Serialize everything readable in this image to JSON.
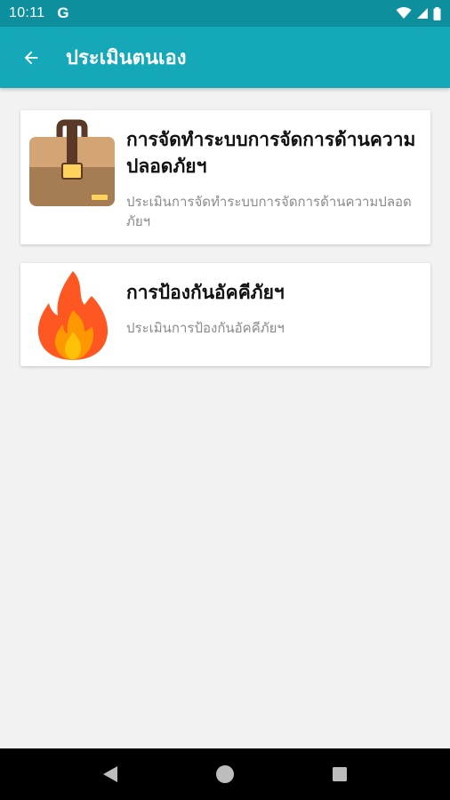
{
  "status_bar": {
    "time": "10:11",
    "google_icon": "G"
  },
  "app_bar": {
    "title": "ประเมินตนเอง",
    "back_icon": "arrow-back-icon"
  },
  "cards": [
    {
      "icon": "briefcase-icon",
      "title": "การจัดทำระบบการจัดการด้านความปลอดภัยฯ",
      "subtitle": "ประเมินการจัดทำระบบการจัดการด้านความปลอดภัยฯ"
    },
    {
      "icon": "fire-icon",
      "title": "การป้องกันอัคคีภัยฯ",
      "subtitle": "ประเมินการป้องกันอัคคีภัยฯ"
    }
  ],
  "nav_bar": {
    "back": "nav-back-icon",
    "home": "nav-home-icon",
    "recents": "nav-recents-icon"
  },
  "colors": {
    "status_bar": "#0e8f9e",
    "app_bar": "#14a8b8",
    "background": "#f2f2f2",
    "card": "#ffffff"
  }
}
